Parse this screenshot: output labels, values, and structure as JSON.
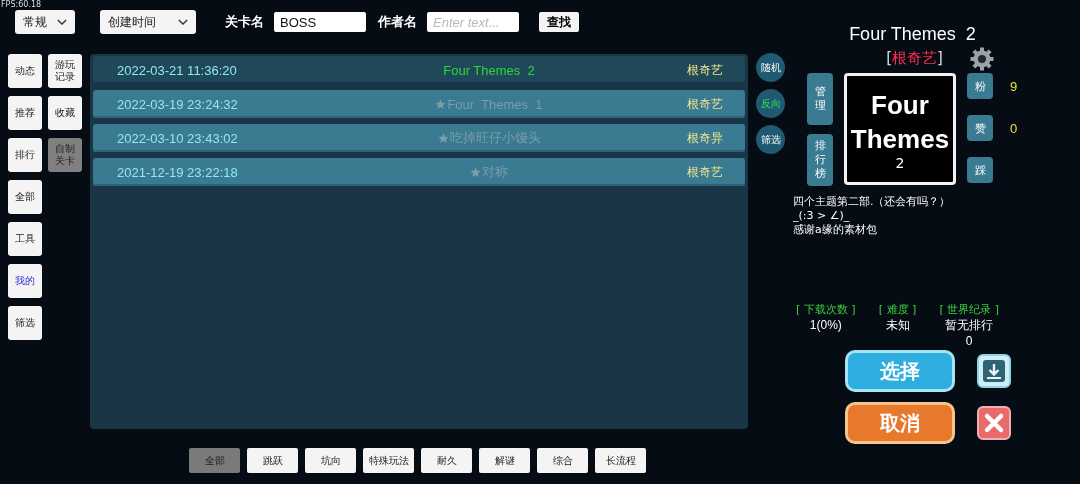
{
  "fps": "FPS:60.18",
  "toolbar": {
    "category_dropdown": "常规",
    "sort_dropdown": "创建时间",
    "level_name": {
      "label": "关卡名",
      "value": "BOSS"
    },
    "author_name": {
      "label": "作者名",
      "placeholder": "Enter text..."
    },
    "search_button": "查找"
  },
  "nav_primary": [
    {
      "label": "动态",
      "selected": false
    },
    {
      "label": "推荐",
      "selected": false
    },
    {
      "label": "排行",
      "selected": false
    },
    {
      "label": "全部",
      "selected": false
    },
    {
      "label": "工具",
      "selected": false
    },
    {
      "label": "我的",
      "selected": true
    },
    {
      "label": "筛选",
      "selected": false
    }
  ],
  "nav_secondary": [
    {
      "label": "游玩记录",
      "selected": false
    },
    {
      "label": "收藏",
      "selected": false
    },
    {
      "label": "自制关卡",
      "selected": true
    }
  ],
  "levels": [
    {
      "date": "2022-03-21 11:36:20",
      "title": "Four Themes  2",
      "author": "根奇艺",
      "starred": false,
      "selected": true
    },
    {
      "date": "2022-03-19 23:24:32",
      "title": "Four  Themes  1",
      "author": "根奇艺",
      "starred": true,
      "selected": false
    },
    {
      "date": "2022-03-10 23:43:02",
      "title": "吃掉旺仔小馒头",
      "author": "根奇异",
      "starred": true,
      "selected": false
    },
    {
      "date": "2021-12-19 23:22:18",
      "title": "对称",
      "author": "根奇艺",
      "starred": true,
      "selected": false
    }
  ],
  "side_buttons": [
    {
      "label": "随机",
      "on": false
    },
    {
      "label": "反向",
      "on": true
    },
    {
      "label": "筛选",
      "on": false
    }
  ],
  "detail": {
    "title": "Four Themes  2",
    "author": {
      "open": "[",
      "name": "根奇艺",
      "close": "]"
    },
    "thumbnail": {
      "title": "Four Themes",
      "subtitle": "2"
    },
    "actions": [
      "管理",
      "排行榜"
    ],
    "ratings": [
      {
        "label": "粉",
        "count": "9"
      },
      {
        "label": "赞",
        "count": "0"
      },
      {
        "label": "踩"
      }
    ],
    "description": [
      "四个主题第二部.（还会有吗？）",
      "_(:3 > ∠)_",
      "感谢a缘的素材包"
    ],
    "stats": [
      {
        "label": "[ 下载次数 ]",
        "values": [
          "1(0%)"
        ]
      },
      {
        "label": "[ 难度 ]",
        "values": [
          "未知"
        ]
      },
      {
        "label": "[ 世界纪录 ]",
        "values": [
          "暂无排行",
          "0"
        ]
      }
    ],
    "select_button": "选择",
    "cancel_button": "取消"
  },
  "category_tabs": [
    {
      "label": "全部",
      "selected": true
    },
    {
      "label": "跳跃",
      "selected": false
    },
    {
      "label": "坑向",
      "selected": false
    },
    {
      "label": "特殊玩法",
      "selected": false
    },
    {
      "label": "耐久",
      "selected": false
    },
    {
      "label": "解谜",
      "selected": false
    },
    {
      "label": "综合",
      "selected": false
    },
    {
      "label": "长流程",
      "selected": false
    }
  ]
}
